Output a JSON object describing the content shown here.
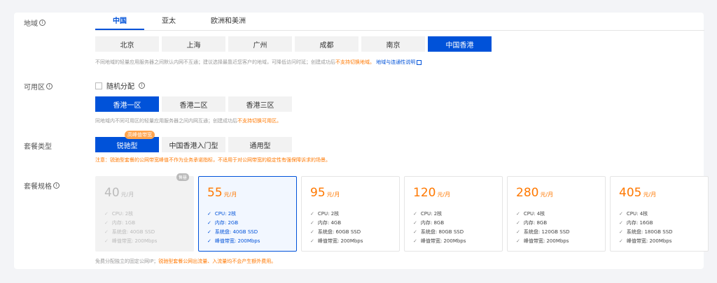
{
  "region": {
    "label": "地域",
    "tabs": [
      "中国",
      "亚太",
      "欧洲和美洲"
    ],
    "cities": [
      "北京",
      "上海",
      "广州",
      "成都",
      "南京",
      "中国香港"
    ],
    "hint_prefix": "不同地域的轻量应用服务器之间默认内网不互通；建议选择最靠近您客户的地域，可降低访问时延；创建成功后",
    "hint_warn": "不支持切换地域。",
    "hint_link": "地域与连通性说明"
  },
  "zone": {
    "label": "可用区",
    "random_label": "随机分配",
    "options": [
      "香港一区",
      "香港二区",
      "香港三区"
    ],
    "hint_prefix": "同地域内不同可用区的轻量应用服务器之间内网互通；创建成功后",
    "hint_warn": "不支持切换可用区。"
  },
  "package_type": {
    "label": "套餐类型",
    "badge": "高峰值带宽",
    "options": [
      "锐驰型",
      "中国香港入门型",
      "通用型"
    ],
    "notice": "注意：锐驰型套餐的公网带宽峰值不作为业务承诺指标，不适用于对公网带宽的稳定性有强保障诉求的场景。"
  },
  "package_spec": {
    "label": "套餐规格",
    "unit": "元/月",
    "soldout_label": "售罄",
    "cards": [
      {
        "price": "40",
        "cpu": "CPU: 2核",
        "mem": "内存: 1GB",
        "disk": "系统盘: 40GB SSD",
        "bw": "峰值带宽: 200Mbps"
      },
      {
        "price": "55",
        "cpu": "CPU: 2核",
        "mem": "内存: 2GB",
        "disk": "系统盘: 40GB SSD",
        "bw": "峰值带宽: 200Mbps"
      },
      {
        "price": "95",
        "cpu": "CPU: 2核",
        "mem": "内存: 4GB",
        "disk": "系统盘: 60GB SSD",
        "bw": "峰值带宽: 200Mbps"
      },
      {
        "price": "120",
        "cpu": "CPU: 2核",
        "mem": "内存: 8GB",
        "disk": "系统盘: 80GB SSD",
        "bw": "峰值带宽: 200Mbps"
      },
      {
        "price": "280",
        "cpu": "CPU: 4核",
        "mem": "内存: 8GB",
        "disk": "系统盘: 120GB SSD",
        "bw": "峰值带宽: 200Mbps"
      },
      {
        "price": "405",
        "cpu": "CPU: 4核",
        "mem": "内存: 16GB",
        "disk": "系统盘: 180GB SSD",
        "bw": "峰值带宽: 200Mbps"
      }
    ],
    "footer_prefix": "免费分配独立的固定公网IP；",
    "footer_warn": "锐驰型套餐公网出流量、入流量均不会产生额外费用。"
  }
}
